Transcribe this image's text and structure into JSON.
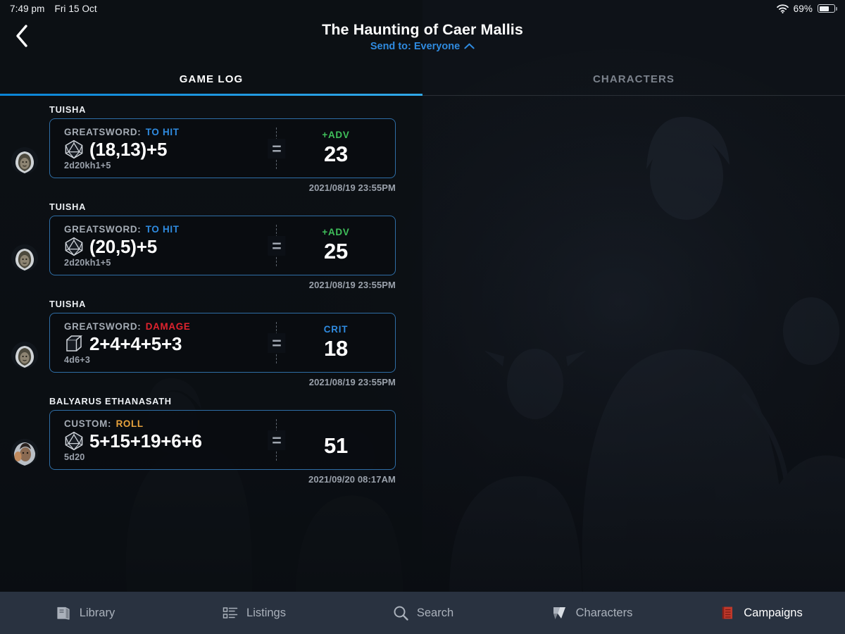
{
  "status_bar": {
    "time": "7:49 pm",
    "date": "Fri 15 Oct",
    "wifi_icon": "wifi-icon",
    "battery_percent": "69%",
    "battery_icon": "battery-icon"
  },
  "header": {
    "back_icon": "back-chevron-icon",
    "title": "The Haunting of Caer Mallis",
    "send_to_label": "Send to: Everyone",
    "send_to_chevron": "chevron-up-icon"
  },
  "tabs": [
    {
      "label": "GAME LOG",
      "active": true
    },
    {
      "label": "CHARACTERS",
      "active": false
    }
  ],
  "colors": {
    "accent_blue": "#2f8be0",
    "card_border": "#2f6ea6",
    "adv_green": "#3fbf5a",
    "damage_red": "#e0232e",
    "custom_orange": "#e8a33d",
    "nav_bar": "#293240",
    "campaigns_red": "#c0392b"
  },
  "log_entries": [
    {
      "character": "TUISHA",
      "avatar": "avatar-tuisha",
      "roll_source": "GREATSWORD:",
      "roll_kind": "TO HIT",
      "roll_kind_class": "tohit",
      "die_icon": "d20-icon",
      "expression": "(18,13)+5",
      "formula": "2d20kh1+5",
      "equals": "=",
      "badge": "+ADV",
      "badge_class": "adv",
      "total": "23",
      "timestamp": "2021/08/19 23:55PM"
    },
    {
      "character": "TUISHA",
      "avatar": "avatar-tuisha",
      "roll_source": "GREATSWORD:",
      "roll_kind": "TO HIT",
      "roll_kind_class": "tohit",
      "die_icon": "d20-icon",
      "expression": "(20,5)+5",
      "formula": "2d20kh1+5",
      "equals": "=",
      "badge": "+ADV",
      "badge_class": "adv",
      "total": "25",
      "timestamp": "2021/08/19 23:55PM"
    },
    {
      "character": "TUISHA",
      "avatar": "avatar-tuisha",
      "roll_source": "GREATSWORD:",
      "roll_kind": "DAMAGE",
      "roll_kind_class": "damage",
      "die_icon": "d6-icon",
      "expression": "2+4+4+5+3",
      "formula": "4d6+3",
      "equals": "=",
      "badge": "CRIT",
      "badge_class": "crit",
      "total": "18",
      "timestamp": "2021/08/19 23:55PM"
    },
    {
      "character": "BALYARUS ETHANASATH",
      "avatar": "avatar-balyarus",
      "roll_source": "CUSTOM:",
      "roll_kind": "ROLL",
      "roll_kind_class": "roll",
      "die_icon": "d20-icon",
      "expression": "5+15+19+6+6",
      "formula": "5d20",
      "equals": "=",
      "badge": "",
      "badge_class": "none",
      "total": "51",
      "timestamp": "2021/09/20 08:17AM"
    }
  ],
  "bottom_nav": [
    {
      "label": "Library",
      "icon": "book-icon",
      "active": false
    },
    {
      "label": "Listings",
      "icon": "list-icon",
      "active": false
    },
    {
      "label": "Search",
      "icon": "search-icon",
      "active": false
    },
    {
      "label": "Characters",
      "icon": "character-banner-icon",
      "active": false
    },
    {
      "label": "Campaigns",
      "icon": "campaign-book-icon",
      "active": true
    }
  ]
}
